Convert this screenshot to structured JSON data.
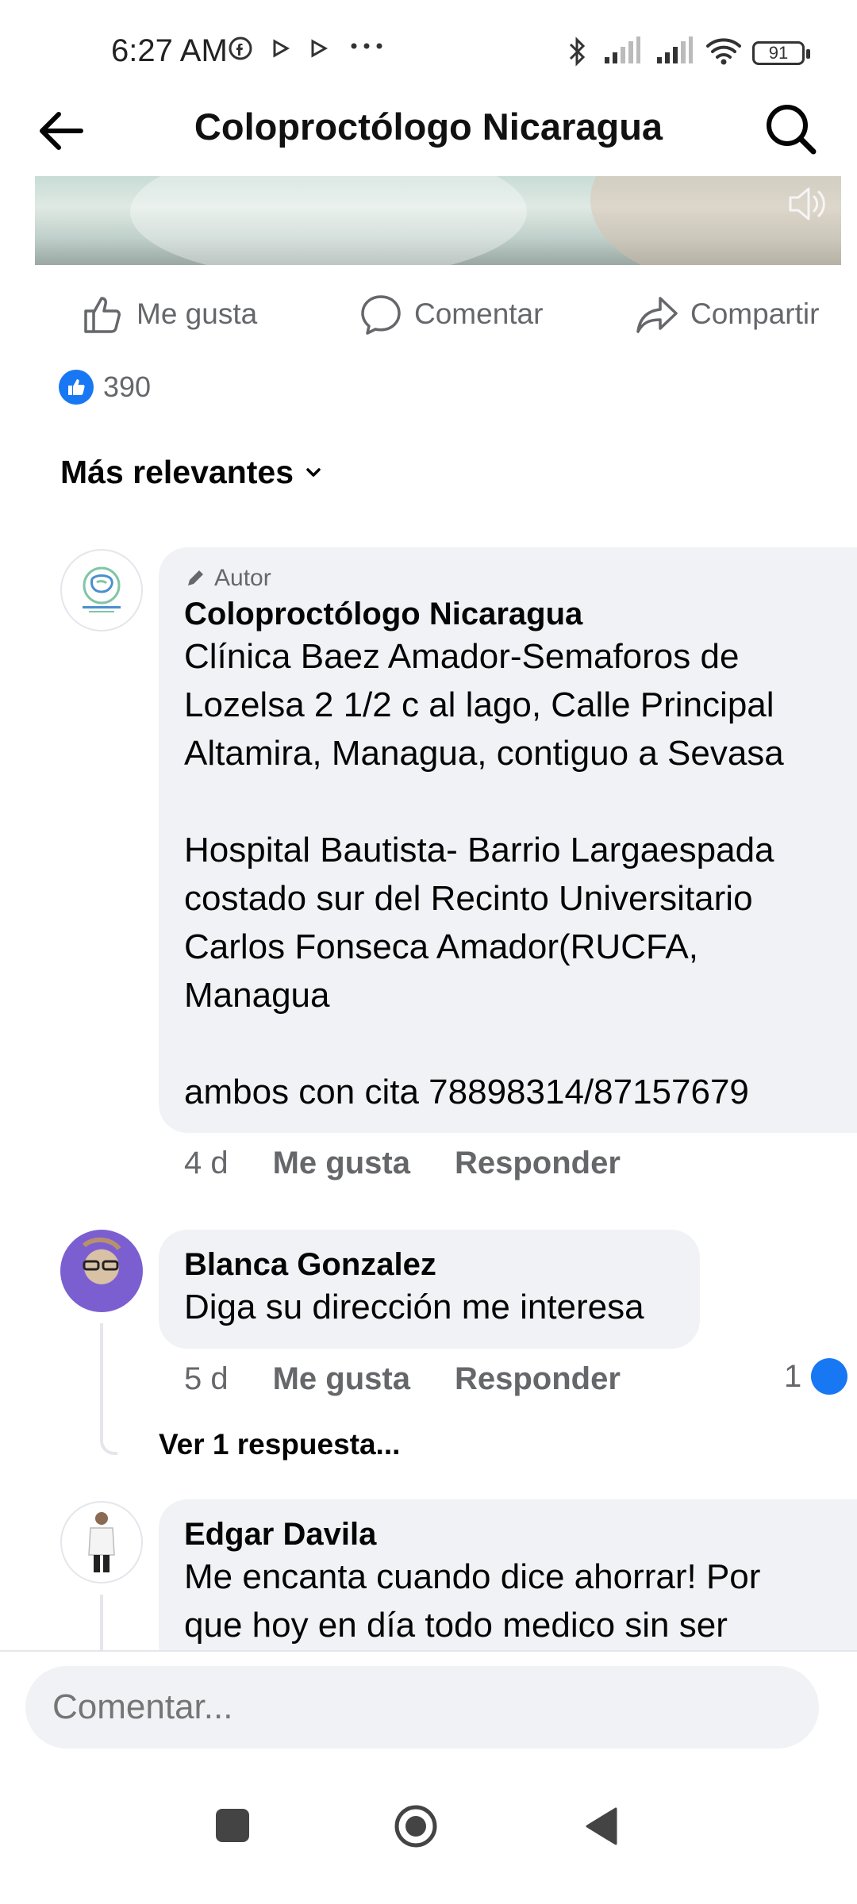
{
  "status_bar": {
    "time": "6:27 AM",
    "battery": "91",
    "icons": [
      "facebook-icon",
      "play-icon",
      "play-icon",
      "more-dots-icon",
      "bluetooth-icon",
      "signal-icon",
      "signal-icon",
      "wifi-icon",
      "battery-icon"
    ]
  },
  "header": {
    "title": "Coloproctólogo Nicaragua"
  },
  "actions": {
    "like": "Me gusta",
    "comment": "Comentar",
    "share": "Compartir"
  },
  "reactions": {
    "count": "390"
  },
  "sort": {
    "label": "Más relevantes"
  },
  "comments": [
    {
      "author_badge": "Autor",
      "name": "Coloproctólogo Nicaragua",
      "text": "Clínica Baez Amador-Semaforos de\nLozelsa 2 1/2 c al lago, Calle Principal\nAltamira, Managua, contiguo a Sevasa\n\nHospital Bautista- Barrio Largaespada\ncostado sur del Recinto Universitario\nCarlos Fonseca Amador(RUCFA,\nManagua\n\nambos con cita 78898314/87157679",
      "time": "4 d",
      "like": "Me gusta",
      "reply": "Responder"
    },
    {
      "name": "Blanca Gonzalez",
      "text": "Diga su dirección me interesa",
      "time": "5 d",
      "like": "Me gusta",
      "reply": "Responder",
      "reaction_count": "1",
      "view_replies": "Ver 1 respuesta..."
    },
    {
      "name": "Edgar Davila",
      "text": "Me encanta cuando dice ahorrar! Por\nque hoy en día todo medico sin ser"
    }
  ],
  "composer": {
    "placeholder": "Comentar..."
  },
  "colors": {
    "brand_blue": "#1877f2",
    "bubble_bg": "#f0f2f5",
    "secondary_text": "#65676b"
  }
}
